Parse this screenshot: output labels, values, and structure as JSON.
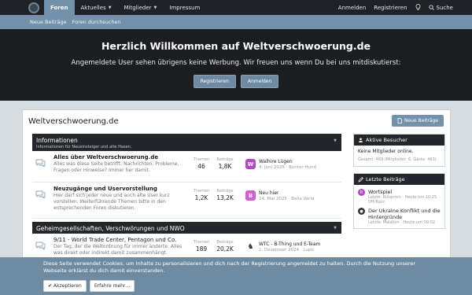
{
  "topnav": {
    "tabs": [
      "Foren",
      "Aktuelles",
      "Mitglieder",
      "Impressum"
    ],
    "login": "Anmelden",
    "register": "Registrieren",
    "search": "Suche"
  },
  "subnav": {
    "items": [
      "Neue Beiträge",
      "Foren durchsuchen"
    ]
  },
  "hero": {
    "title": "Herzlich Willkommen auf Weltverschwoerung.de",
    "subtitle": "Angemeldete User sehen übrigens keine Werbung. Wir freuen uns wenn Du bei uns mitdiskutierst:",
    "register_btn": "Registrieren",
    "login_btn": "Anmelden"
  },
  "main": {
    "title": "Weltverschwoerung.de",
    "new_posts_btn": "Neue Beiträge",
    "categories": [
      {
        "title": "Informationen",
        "desc": "Informationen für Neueinsteiger und alte Hasen.",
        "nodes": [
          {
            "title": "Alles über Weltverschwoerung.de",
            "desc": "Alles was diese Seite betrifft. Nachrichten, Probleme, Fragen oder Hinweise? Immer her damit.",
            "threads_label": "Themen",
            "threads": "46",
            "posts_label": "Beiträge",
            "posts": "1,8K",
            "avatar": "W",
            "last_title": "Walhire Lügen",
            "last_date": "4. Juni 2025",
            "last_user": "Bunter Hund"
          },
          {
            "title": "Neuzugänge und Uservorstellung",
            "desc": "Hier darf sich jeder neue und auch alte User kurz vorstellen. Weiterführende Themen bitte in den entsprechenden Foren diskutieren.",
            "threads_label": "Themen",
            "threads": "1,2K",
            "posts_label": "Beiträge",
            "posts": "13,2K",
            "avatar": "B",
            "last_title": "Neu hier",
            "last_date": "24. Mai 2025",
            "last_user": "Bella Varla"
          }
        ]
      },
      {
        "title": "Geheimgesellschaften, Verschwörungen und NWO",
        "nodes": [
          {
            "title": "9/11 - World Trade Center, Pentagon und Co.",
            "desc": "Der Tag, der die Weltordnung für immer änderte. Alles was direkt oder indirekt damit zusammenhängt.",
            "threads_label": "Themen",
            "threads": "189",
            "posts_label": "Beiträge",
            "posts": "20,2K",
            "avatar": "♞",
            "last_title": "WTC - B-Thing und E-Team",
            "last_date": "1. Dezember 2024",
            "last_user": "Lupo"
          }
        ]
      }
    ]
  },
  "sidebar": {
    "active_visitors": {
      "title": "Aktive Besucher",
      "text": "Keine Mitglieder online.",
      "meta": "Gesamt: 469 (Mitglieder: 6, Gäste: 463)"
    },
    "latest_posts": {
      "title": "Letzte Beiträge",
      "items": [
        {
          "avatar": "R",
          "title": "Wortspiel",
          "meta": "Letzte: Rülspmin · Heute um 10:25",
          "forum": "Off-Topic"
        },
        {
          "avatar": "●",
          "title": "Der Ukraine Konflikt und die Hintergründe",
          "meta": "Letzte: Malakim · Heute um 09:02"
        }
      ]
    }
  },
  "cookie": {
    "text": "Diese Seite verwendet Cookies, um Inhalte zu personalisieren und dich nach der Registrierung angemeldet zu halten. Durch die Nutzung unserer Webseite erklärst du dich damit einverstanden.",
    "accept": "Akzeptieren",
    "more": "Erfahre mehr…"
  }
}
